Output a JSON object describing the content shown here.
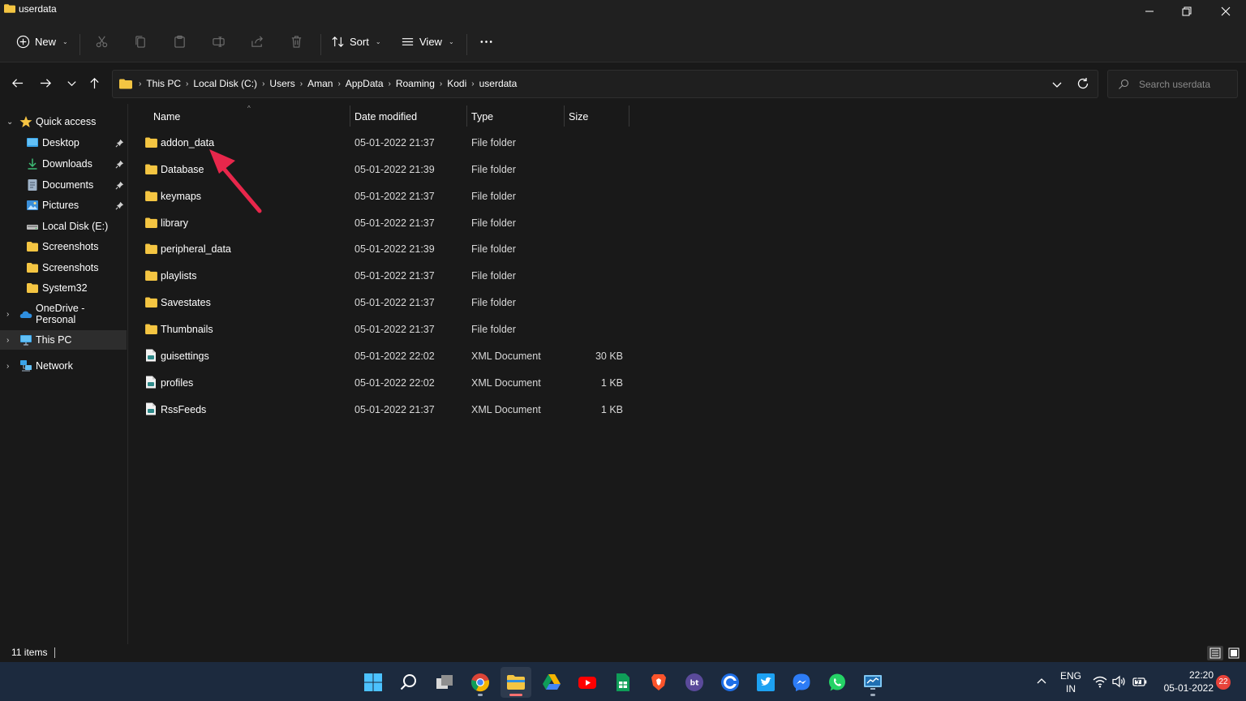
{
  "window": {
    "title": "userdata"
  },
  "toolbar": {
    "new_label": "New",
    "sort_label": "Sort",
    "view_label": "View"
  },
  "address": {
    "crumbs": [
      "This PC",
      "Local Disk (C:)",
      "Users",
      "Aman",
      "AppData",
      "Roaming",
      "Kodi",
      "userdata"
    ]
  },
  "search": {
    "placeholder": "Search userdata"
  },
  "sidebar": {
    "quick_access": "Quick access",
    "items": [
      {
        "label": "Desktop",
        "icon": "desktop-icon",
        "pinned": true
      },
      {
        "label": "Downloads",
        "icon": "download-icon",
        "pinned": true
      },
      {
        "label": "Documents",
        "icon": "document-icon",
        "pinned": true
      },
      {
        "label": "Pictures",
        "icon": "pictures-icon",
        "pinned": true
      },
      {
        "label": "Local Disk (E:)",
        "icon": "drive-icon",
        "pinned": false
      },
      {
        "label": "Screenshots",
        "icon": "folder-icon",
        "pinned": false
      },
      {
        "label": "Screenshots",
        "icon": "folder-icon",
        "pinned": false
      },
      {
        "label": "System32",
        "icon": "folder-icon",
        "pinned": false
      }
    ],
    "onedrive": "OneDrive - Personal",
    "this_pc": "This PC",
    "network": "Network"
  },
  "columns": {
    "name": "Name",
    "date": "Date modified",
    "type": "Type",
    "size": "Size"
  },
  "files": [
    {
      "name": "addon_data",
      "date": "05-01-2022 21:37",
      "type": "File folder",
      "size": "",
      "kind": "folder"
    },
    {
      "name": "Database",
      "date": "05-01-2022 21:39",
      "type": "File folder",
      "size": "",
      "kind": "folder"
    },
    {
      "name": "keymaps",
      "date": "05-01-2022 21:37",
      "type": "File folder",
      "size": "",
      "kind": "folder"
    },
    {
      "name": "library",
      "date": "05-01-2022 21:37",
      "type": "File folder",
      "size": "",
      "kind": "folder"
    },
    {
      "name": "peripheral_data",
      "date": "05-01-2022 21:39",
      "type": "File folder",
      "size": "",
      "kind": "folder"
    },
    {
      "name": "playlists",
      "date": "05-01-2022 21:37",
      "type": "File folder",
      "size": "",
      "kind": "folder"
    },
    {
      "name": "Savestates",
      "date": "05-01-2022 21:37",
      "type": "File folder",
      "size": "",
      "kind": "folder"
    },
    {
      "name": "Thumbnails",
      "date": "05-01-2022 21:37",
      "type": "File folder",
      "size": "",
      "kind": "folder"
    },
    {
      "name": "guisettings",
      "date": "05-01-2022 22:02",
      "type": "XML Document",
      "size": "30 KB",
      "kind": "xml"
    },
    {
      "name": "profiles",
      "date": "05-01-2022 22:02",
      "type": "XML Document",
      "size": "1 KB",
      "kind": "xml"
    },
    {
      "name": "RssFeeds",
      "date": "05-01-2022 21:37",
      "type": "XML Document",
      "size": "1 KB",
      "kind": "xml"
    }
  ],
  "status": {
    "item_count": "11 items"
  },
  "taskbar": {
    "apps": [
      "start-icon",
      "search-icon",
      "task-view-icon",
      "chrome-icon",
      "file-explorer-icon",
      "google-drive-icon",
      "youtube-icon",
      "sheets-icon",
      "brave-icon",
      "bt-icon",
      "c-app-icon",
      "twitter-icon",
      "messenger-icon",
      "whatsapp-icon",
      "monitor-app-icon"
    ],
    "lang_line1": "ENG",
    "lang_line2": "IN",
    "time": "22:20",
    "date": "05-01-2022",
    "notifications": "22"
  },
  "colors": {
    "background": "#191919",
    "chrome": "#202020",
    "folder": "#f4c542",
    "taskbar": "#1c2a3e",
    "annotation_arrow": "#e8274b"
  }
}
